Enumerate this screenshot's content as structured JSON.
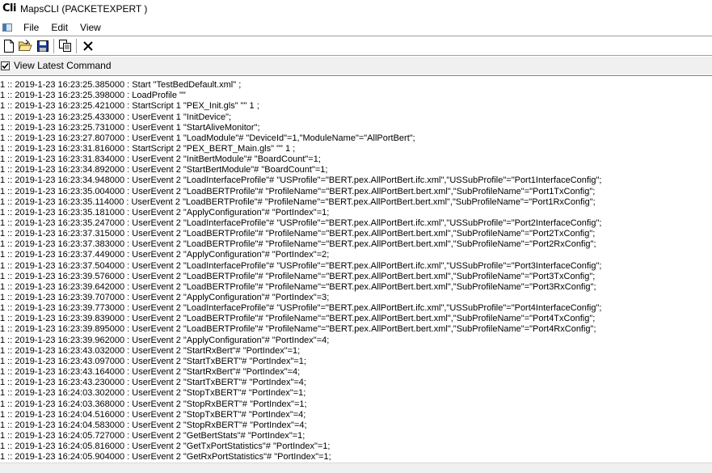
{
  "window": {
    "icon_text": "Cli",
    "title": "MapsCLI  (PACKETEXPERT  )"
  },
  "menu": {
    "items": [
      "File",
      "Edit",
      "View"
    ]
  },
  "toolbar": {
    "buttons": [
      "new-icon",
      "open-icon",
      "save-icon",
      "copy-icon",
      "close-icon"
    ]
  },
  "options": {
    "view_latest_label": "View Latest Command",
    "view_latest_checked": true
  },
  "log": {
    "lines": [
      "1 :: 2019-1-23 16:23:25.385000 : Start \"TestBedDefault.xml\" ;",
      "1 :: 2019-1-23 16:23:25.398000 : LoadProfile \"\"",
      "1 :: 2019-1-23 16:23:25.421000 : StartScript 1 \"PEX_Init.gls\" \"\" 1 ;",
      "1 :: 2019-1-23 16:23:25.433000 : UserEvent 1 \"InitDevice\";",
      "1 :: 2019-1-23 16:23:25.731000 : UserEvent 1 \"StartAliveMonitor\";",
      "1 :: 2019-1-23 16:23:27.807000 : UserEvent 1 \"LoadModule\"# \"DeviceId\"=1,\"ModuleName\"=\"AllPortBert\";",
      "1 :: 2019-1-23 16:23:31.816000 : StartScript 2 \"PEX_BERT_Main.gls\" \"\" 1 ;",
      "1 :: 2019-1-23 16:23:31.834000 : UserEvent 2 \"InitBertModule\"# \"BoardCount\"=1;",
      "1 :: 2019-1-23 16:23:34.892000 : UserEvent 2 \"StartBertModule\"# \"BoardCount\"=1;",
      "1 :: 2019-1-23 16:23:34.948000 : UserEvent 2 \"LoadInterfaceProfile\"# \"USProfile\"=\"BERT.pex.AllPortBert.ifc.xml\",\"USSubProfile\"=\"Port1InterfaceConfig\";",
      "1 :: 2019-1-23 16:23:35.004000 : UserEvent 2 \"LoadBERTProfile\"# \"ProfileName\"=\"BERT.pex.AllPortBert.bert.xml\",\"SubProfileName\"=\"Port1TxConfig\";",
      "1 :: 2019-1-23 16:23:35.114000 : UserEvent 2 \"LoadBERTProfile\"# \"ProfileName\"=\"BERT.pex.AllPortBert.bert.xml\",\"SubProfileName\"=\"Port1RxConfig\";",
      "1 :: 2019-1-23 16:23:35.181000 : UserEvent 2 \"ApplyConfiguration\"# \"PortIndex\"=1;",
      "1 :: 2019-1-23 16:23:35.247000 : UserEvent 2 \"LoadInterfaceProfile\"# \"USProfile\"=\"BERT.pex.AllPortBert.ifc.xml\",\"USSubProfile\"=\"Port2InterfaceConfig\";",
      "1 :: 2019-1-23 16:23:37.315000 : UserEvent 2 \"LoadBERTProfile\"# \"ProfileName\"=\"BERT.pex.AllPortBert.bert.xml\",\"SubProfileName\"=\"Port2TxConfig\";",
      "1 :: 2019-1-23 16:23:37.383000 : UserEvent 2 \"LoadBERTProfile\"# \"ProfileName\"=\"BERT.pex.AllPortBert.bert.xml\",\"SubProfileName\"=\"Port2RxConfig\";",
      "1 :: 2019-1-23 16:23:37.449000 : UserEvent 2 \"ApplyConfiguration\"# \"PortIndex\"=2;",
      "1 :: 2019-1-23 16:23:37.504000 : UserEvent 2 \"LoadInterfaceProfile\"# \"USProfile\"=\"BERT.pex.AllPortBert.ifc.xml\",\"USSubProfile\"=\"Port3InterfaceConfig\";",
      "1 :: 2019-1-23 16:23:39.576000 : UserEvent 2 \"LoadBERTProfile\"# \"ProfileName\"=\"BERT.pex.AllPortBert.bert.xml\",\"SubProfileName\"=\"Port3TxConfig\";",
      "1 :: 2019-1-23 16:23:39.642000 : UserEvent 2 \"LoadBERTProfile\"# \"ProfileName\"=\"BERT.pex.AllPortBert.bert.xml\",\"SubProfileName\"=\"Port3RxConfig\";",
      "1 :: 2019-1-23 16:23:39.707000 : UserEvent 2 \"ApplyConfiguration\"# \"PortIndex\"=3;",
      "1 :: 2019-1-23 16:23:39.773000 : UserEvent 2 \"LoadInterfaceProfile\"# \"USProfile\"=\"BERT.pex.AllPortBert.ifc.xml\",\"USSubProfile\"=\"Port4InterfaceConfig\";",
      "1 :: 2019-1-23 16:23:39.839000 : UserEvent 2 \"LoadBERTProfile\"# \"ProfileName\"=\"BERT.pex.AllPortBert.bert.xml\",\"SubProfileName\"=\"Port4TxConfig\";",
      "1 :: 2019-1-23 16:23:39.895000 : UserEvent 2 \"LoadBERTProfile\"# \"ProfileName\"=\"BERT.pex.AllPortBert.bert.xml\",\"SubProfileName\"=\"Port4RxConfig\";",
      "1 :: 2019-1-23 16:23:39.962000 : UserEvent 2 \"ApplyConfiguration\"# \"PortIndex\"=4;",
      "1 :: 2019-1-23 16:23:43.032000 : UserEvent 2 \"StartRxBert\"# \"PortIndex\"=1;",
      "1 :: 2019-1-23 16:23:43.097000 : UserEvent 2 \"StartTxBERT\"# \"PortIndex\"=1;",
      "1 :: 2019-1-23 16:23:43.164000 : UserEvent 2 \"StartRxBert\"# \"PortIndex\"=4;",
      "1 :: 2019-1-23 16:23:43.230000 : UserEvent 2 \"StartTxBERT\"# \"PortIndex\"=4;",
      "1 :: 2019-1-23 16:24:03.302000 : UserEvent 2 \"StopTxBERT\"# \"PortIndex\"=1;",
      "1 :: 2019-1-23 16:24:03.368000 : UserEvent 2 \"StopRxBERT\"# \"PortIndex\"=1;",
      "1 :: 2019-1-23 16:24:04.516000 : UserEvent 2 \"StopTxBERT\"# \"PortIndex\"=4;",
      "1 :: 2019-1-23 16:24:04.583000 : UserEvent 2 \"StopRxBERT\"# \"PortIndex\"=4;",
      "1 :: 2019-1-23 16:24:05.727000 : UserEvent 2 \"GetBertStats\"# \"PortIndex\"=1;",
      "1 :: 2019-1-23 16:24:05.816000 : UserEvent 2 \"GetTxPortStatistics\"# \"PortIndex\"=1;",
      "1 :: 2019-1-23 16:24:05.904000 : UserEvent 2 \"GetRxPortStatistics\"# \"PortIndex\"=1;"
    ]
  }
}
